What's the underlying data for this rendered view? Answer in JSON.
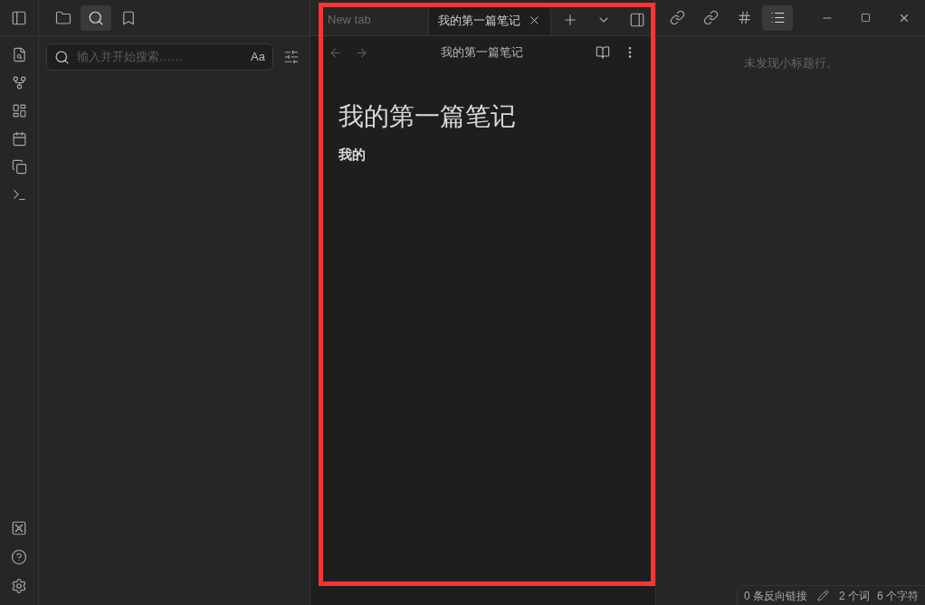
{
  "left_sidebar": {
    "tabs": [
      {
        "selected": false
      },
      {
        "selected": true
      },
      {
        "selected": false
      }
    ],
    "search": {
      "placeholder": "输入并开始搜索……",
      "match_case": "Aa"
    }
  },
  "editor": {
    "tabs": [
      {
        "label": "New tab",
        "selected": false
      },
      {
        "label": "我的第一篇笔记",
        "selected": true
      }
    ],
    "view_title": "我的第一篇笔记",
    "heading": "我的第一篇笔记",
    "body": "我的"
  },
  "right_sidebar": {
    "tabs": [
      {
        "selected": false
      },
      {
        "selected": false
      },
      {
        "selected": false
      },
      {
        "selected": true
      }
    ],
    "empty_message": "未发现小标题行。"
  },
  "status_bar": {
    "backlinks": "0 条反向链接",
    "words": "2 个词",
    "characters": "6 个字符"
  }
}
